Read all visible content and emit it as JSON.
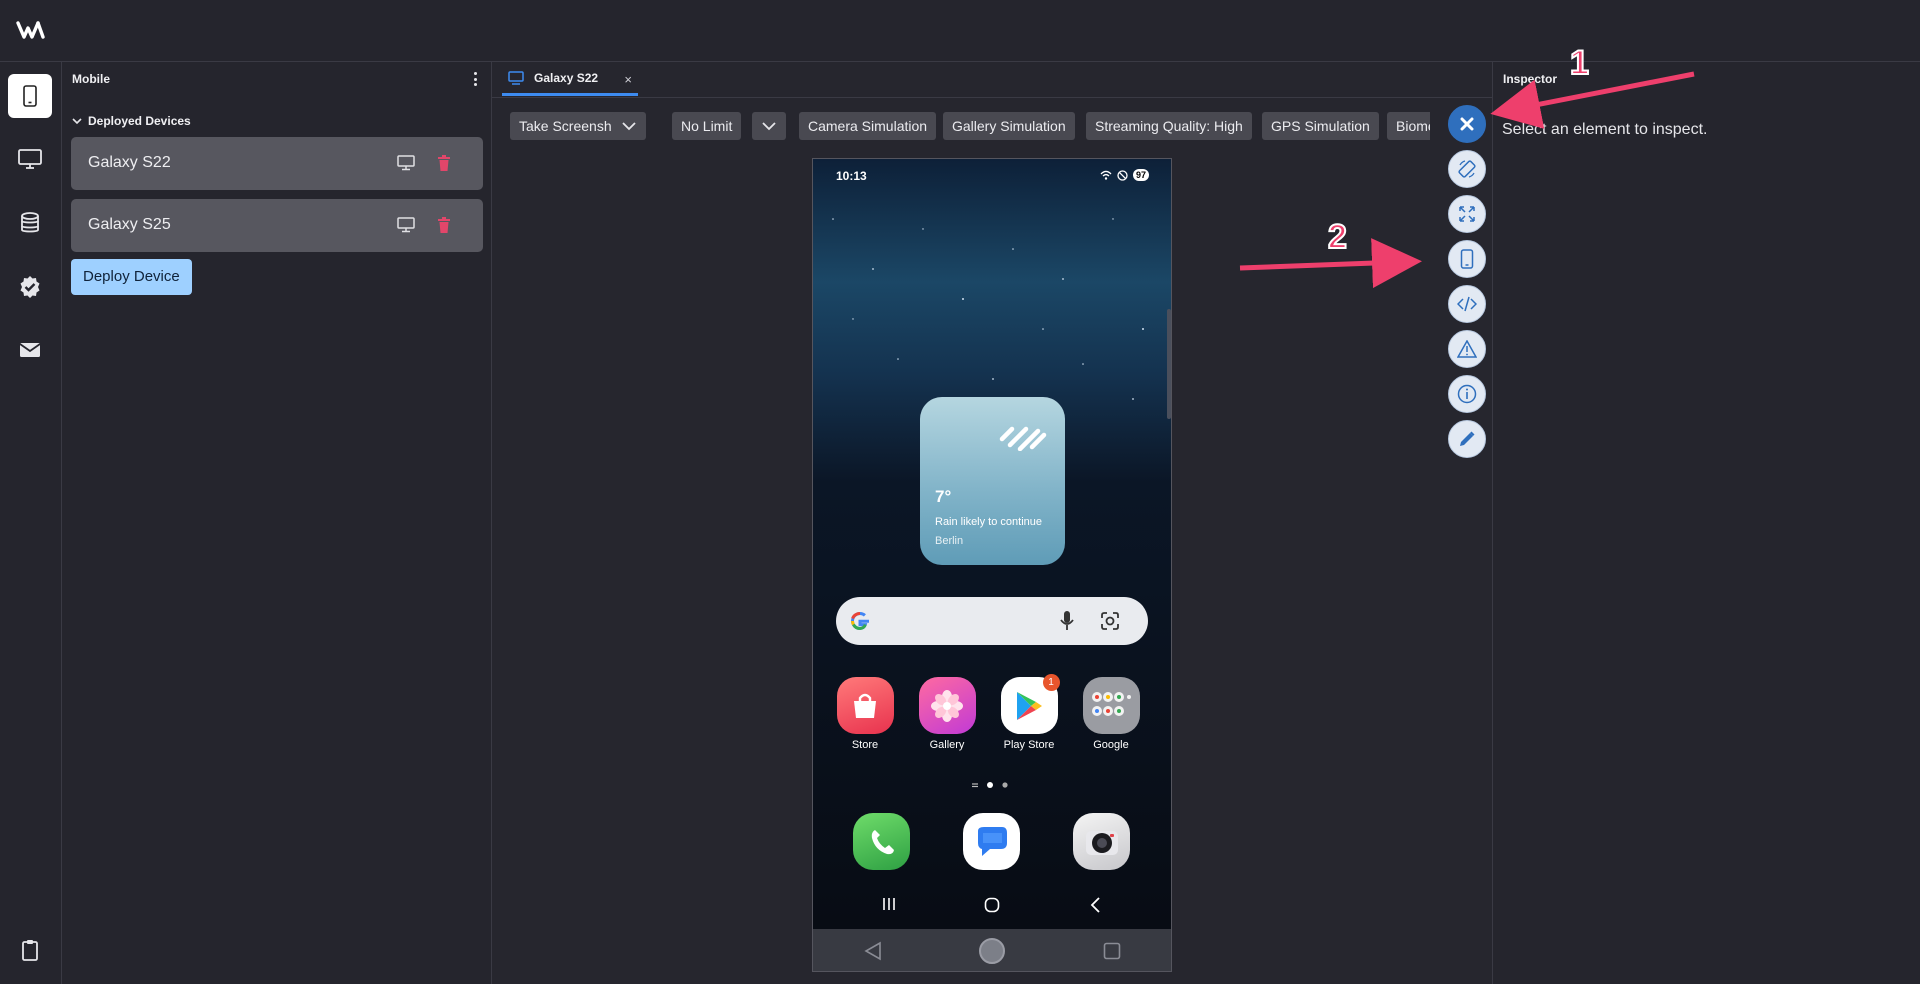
{
  "app": {
    "logo_icon": "wm-logo"
  },
  "rail": {
    "items": [
      {
        "icon": "phone-icon",
        "active": true
      },
      {
        "icon": "monitor-icon"
      },
      {
        "icon": "database-icon"
      },
      {
        "icon": "settings-badge-icon"
      },
      {
        "icon": "mail-icon"
      },
      {
        "icon": "clipboard-icon"
      }
    ]
  },
  "left_panel": {
    "title": "Mobile",
    "section_label": "Deployed Devices",
    "devices": [
      {
        "name": "Galaxy S22"
      },
      {
        "name": "Galaxy S25"
      }
    ],
    "deploy_button": "Deploy Device"
  },
  "tabs": [
    {
      "label": "Galaxy S22",
      "close": "×"
    }
  ],
  "toolbar": {
    "take_screenshot": "Take Screenshot",
    "limit": "No Limit",
    "camera": "Camera Simulation",
    "gallery": "Gallery Simulation",
    "streaming": "Streaming Quality: High",
    "gps": "GPS Simulation",
    "biometric": "Biome"
  },
  "phone": {
    "time": "10:13",
    "battery": "97",
    "weather": {
      "temp": "7°",
      "desc": "Rain likely to continue",
      "city": "Berlin"
    },
    "apps": [
      {
        "label": "Store"
      },
      {
        "label": "Gallery"
      },
      {
        "label": "Play Store",
        "badge": "1"
      },
      {
        "label": "Google"
      }
    ]
  },
  "side_actions": [
    "close-icon",
    "rotate-icon",
    "fullscreen-icon",
    "device-frame-icon",
    "code-icon",
    "warning-icon",
    "info-icon",
    "pencil-icon"
  ],
  "inspector": {
    "title": "Inspector",
    "message": "Select an element to inspect."
  },
  "annotations": {
    "marker_1": "1",
    "marker_2": "2",
    "color": "#ee3f6c"
  },
  "colors": {
    "accent": "#3d8bf0",
    "deploy": "#9ed0ff",
    "delete": "#e2466a"
  }
}
